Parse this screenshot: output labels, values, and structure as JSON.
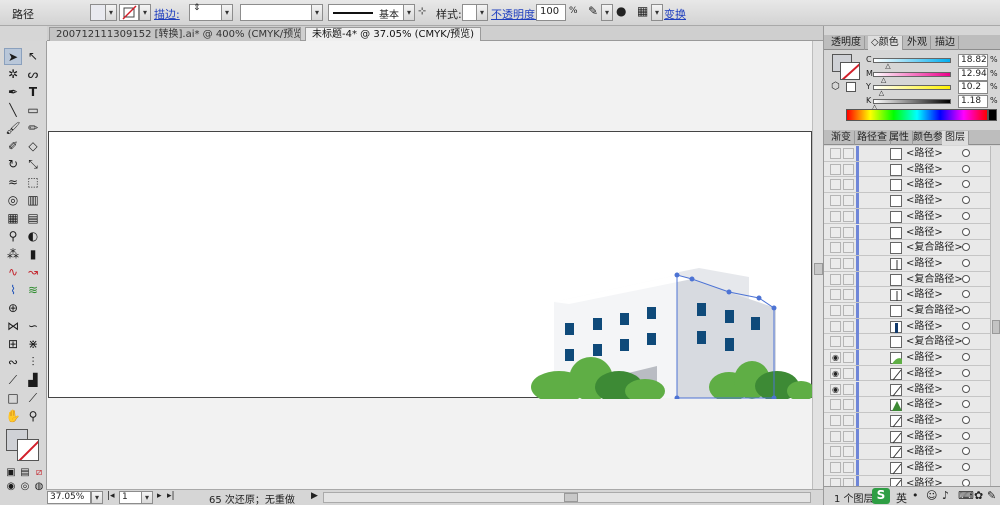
{
  "control_bar": {
    "object_type": "路径",
    "stroke_label": "描边:",
    "brush_value": "基本",
    "style_label": "样式:",
    "opacity_label": "不透明度:",
    "opacity_value": "100",
    "opacity_unit": "%",
    "transform_label": "变换"
  },
  "doc_tabs": [
    {
      "label": "200712111309152 [转换].ai* @ 400% (CMYK/预览)",
      "close": "×"
    },
    {
      "label": "未标题-4* @ 37.05% (CMYK/预览)",
      "close": "×"
    }
  ],
  "status_bar": {
    "zoom": "37.05%",
    "page": "1",
    "history_text": "65 次还原；无重做"
  },
  "color_panel": {
    "tabs": [
      "透明度",
      "颜色",
      "外观",
      "描边"
    ],
    "active_tab": 1,
    "channels": [
      {
        "name": "C",
        "value": "18.82",
        "level": 0.1882,
        "color": "#00aeef"
      },
      {
        "name": "M",
        "value": "12.94",
        "level": 0.1294,
        "color": "#ec008c"
      },
      {
        "name": "Y",
        "value": "10.2",
        "level": 0.102,
        "color": "#fff200"
      },
      {
        "name": "K",
        "value": "1.18",
        "level": 0.0118,
        "color": "#000000"
      }
    ],
    "unit": "%",
    "fill_color": "#cfd1d6"
  },
  "layers_panel": {
    "tabs": [
      "渐变",
      "路径查",
      "属性",
      "颜色参",
      "图层"
    ],
    "active_tab": 4,
    "rows": [
      {
        "name": "<路径>",
        "thumb": "plain",
        "eye": false
      },
      {
        "name": "<路径>",
        "thumb": "plain",
        "eye": false
      },
      {
        "name": "<路径>",
        "thumb": "plain",
        "eye": false
      },
      {
        "name": "<路径>",
        "thumb": "plain",
        "eye": false
      },
      {
        "name": "<路径>",
        "thumb": "plain",
        "eye": false
      },
      {
        "name": "<路径>",
        "thumb": "plain",
        "eye": false
      },
      {
        "name": "<复合路径>",
        "thumb": "plain",
        "eye": false
      },
      {
        "name": "<路径>",
        "thumb": "line",
        "eye": false
      },
      {
        "name": "<复合路径>",
        "thumb": "plain",
        "eye": false
      },
      {
        "name": "<路径>",
        "thumb": "line",
        "eye": false
      },
      {
        "name": "<复合路径>",
        "thumb": "plain",
        "eye": false
      },
      {
        "name": "<路径>",
        "thumb": "dark",
        "eye": false
      },
      {
        "name": "<复合路径>",
        "thumb": "plain",
        "eye": false
      },
      {
        "name": "<路径>",
        "thumb": "green",
        "eye": true
      },
      {
        "name": "<路径>",
        "thumb": "slash",
        "eye": true
      },
      {
        "name": "<路径>",
        "thumb": "slash",
        "eye": true
      },
      {
        "name": "<路径>",
        "thumb": "tree",
        "eye": false
      },
      {
        "name": "<路径>",
        "thumb": "slash",
        "eye": false
      },
      {
        "name": "<路径>",
        "thumb": "slash",
        "eye": false
      },
      {
        "name": "<路径>",
        "thumb": "slash",
        "eye": false
      },
      {
        "name": "<路径>",
        "thumb": "slash",
        "eye": false
      },
      {
        "name": "<路径>",
        "thumb": "slash",
        "eye": false
      }
    ],
    "footer_text": "1 个图层",
    "ime_text": "英"
  },
  "artwork": {
    "building_front": "#f4f5f7",
    "building_side": "#d7dae0",
    "window_color": "#0f4a7a",
    "tree_color": "#5fae45",
    "tree_dark": "#3d8a35",
    "selection_color": "#4d73d4"
  }
}
